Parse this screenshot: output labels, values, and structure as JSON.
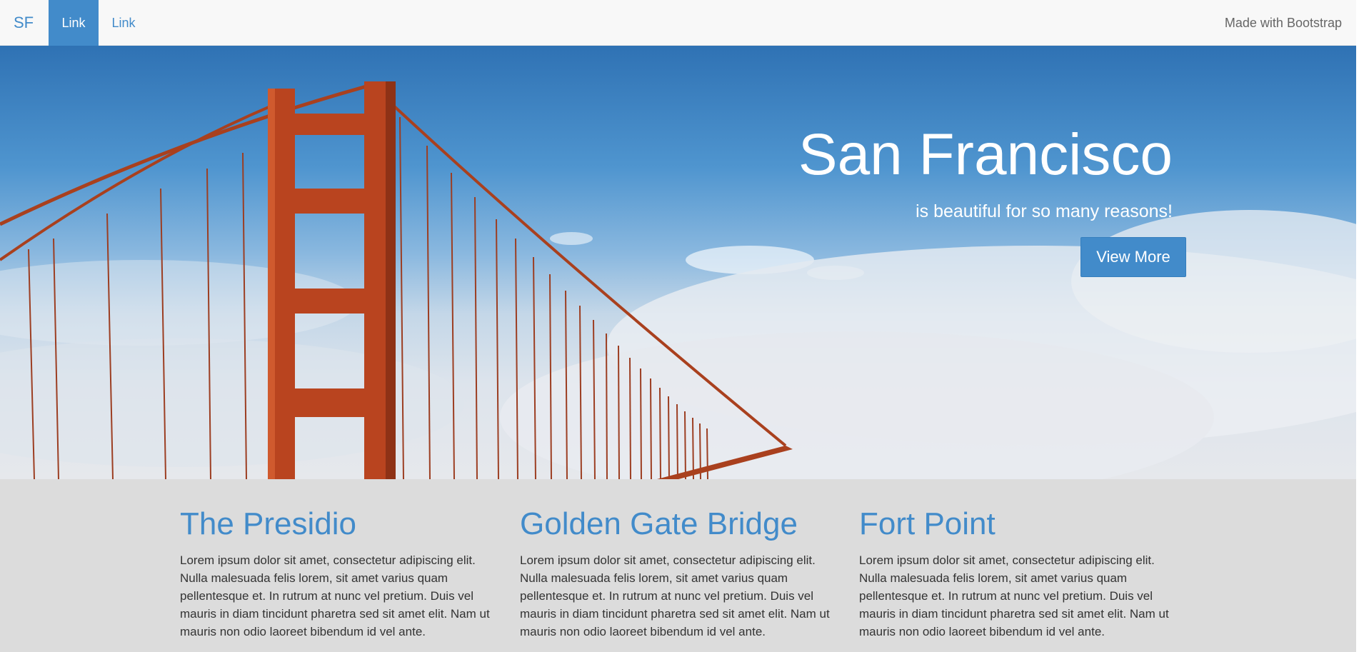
{
  "navbar": {
    "brand": "SF",
    "links": [
      {
        "label": "Link",
        "active": true
      },
      {
        "label": "Link",
        "active": false
      }
    ],
    "right_text": "Made with Bootstrap"
  },
  "hero": {
    "title": "San Francisco",
    "subtitle": "is beautiful for so many reasons!",
    "button_label": "View More"
  },
  "columns": [
    {
      "title": "The Presidio",
      "text": "Lorem ipsum dolor sit amet, consectetur adipiscing elit. Nulla malesuada felis lorem, sit amet varius quam pellentesque et. In rutrum at nunc vel pretium. Duis vel mauris in diam tincidunt pharetra sed sit amet elit. Nam ut mauris non odio laoreet bibendum id vel ante."
    },
    {
      "title": "Golden Gate Bridge",
      "text": "Lorem ipsum dolor sit amet, consectetur adipiscing elit. Nulla malesuada felis lorem, sit amet varius quam pellentesque et. In rutrum at nunc vel pretium. Duis vel mauris in diam tincidunt pharetra sed sit amet elit. Nam ut mauris non odio laoreet bibendum id vel ante."
    },
    {
      "title": "Fort Point",
      "text": "Lorem ipsum dolor sit amet, consectetur adipiscing elit. Nulla malesuada felis lorem, sit amet varius quam pellentesque et. In rutrum at nunc vel pretium. Duis vel mauris in diam tincidunt pharetra sed sit amet elit. Nam ut mauris non odio laoreet bibendum id vel ante."
    }
  ],
  "colors": {
    "primary": "#428bca",
    "navbar_bg": "#f8f8f8",
    "page_bg": "#dcdcdc",
    "bridge": "#b9441f"
  }
}
